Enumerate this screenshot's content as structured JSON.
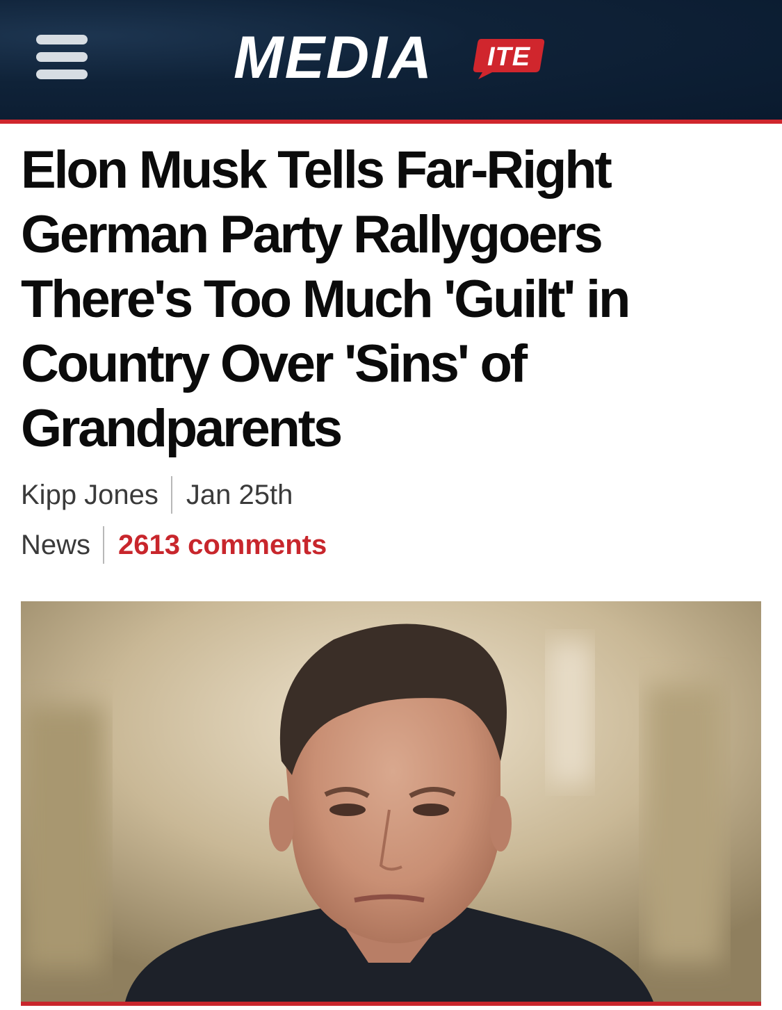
{
  "header": {
    "logo_main": "MEDIA",
    "logo_bubble": "ITE",
    "menu_icon": "hamburger-menu-icon",
    "brand_red": "#d0262d",
    "brand_navy": "#0d2035"
  },
  "article": {
    "headline": "Elon Musk Tells Far-Right German Party Rallygoers There's Too Much 'Guilt' in Country Over 'Sins' of Grandparents",
    "author": "Kipp Jones",
    "date": "Jan 25th",
    "category": "News",
    "comments": "2613 comments",
    "comments_color": "#c8262c"
  },
  "hero_image": {
    "subject": "man-portrait-video-still"
  }
}
